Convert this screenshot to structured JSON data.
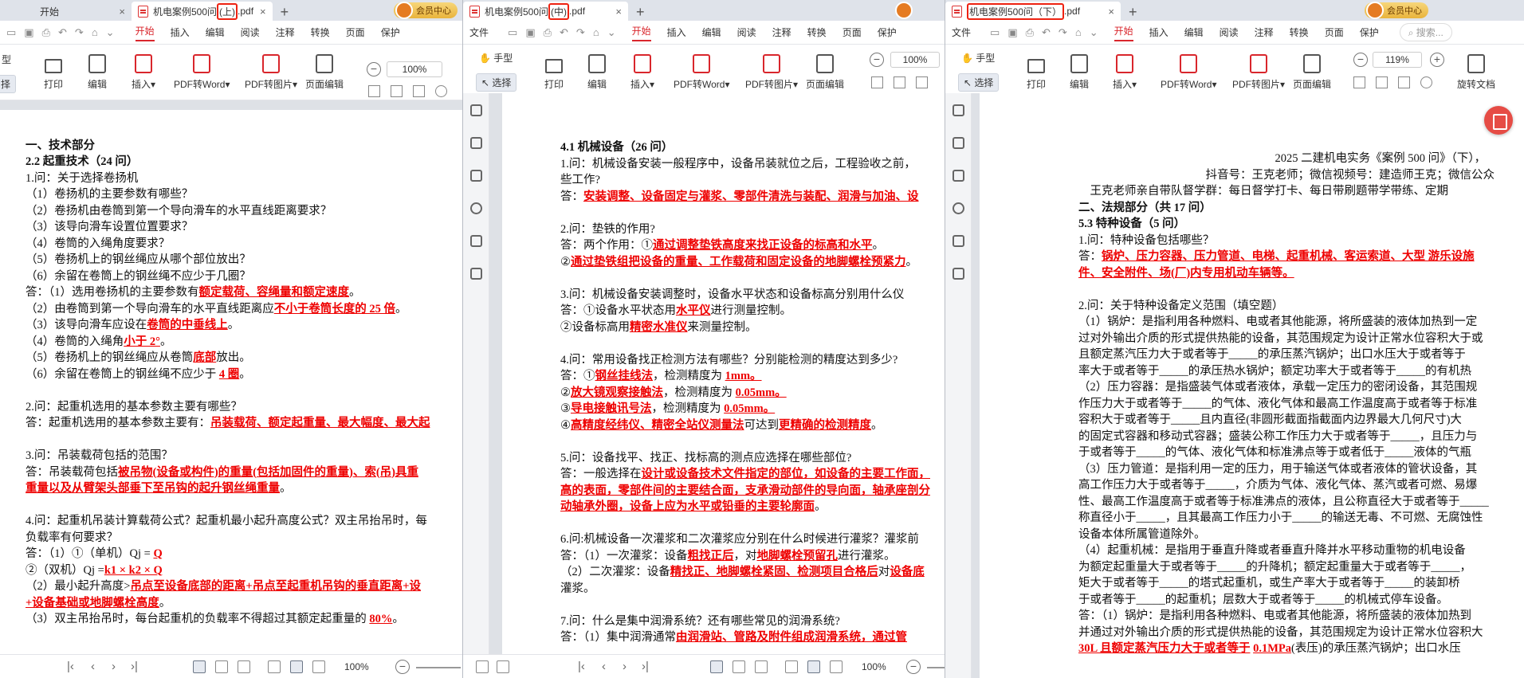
{
  "windows": [
    {
      "tabs": [
        {
          "label": "开始"
        },
        {
          "label_pre": "机电案例500问",
          "label_hl": "(上)",
          "label_post": ".pdf"
        }
      ],
      "vip": "会员中心",
      "menu": [
        "开始",
        "插入",
        "编辑",
        "阅读",
        "注释",
        "转换",
        "页面",
        "保护"
      ],
      "ribbon": {
        "print": "打印",
        "edit": "编辑",
        "insert": "插入",
        "pdf2word": "PDF转Word",
        "pdf2img": "PDF转图片",
        "pageedit": "页面编辑",
        "tool1": "型",
        "tool2": "择",
        "zoom": "100%"
      },
      "status": {
        "zoom": "100%"
      },
      "lines": [
        {
          "segs": [
            {
              "t": ""
            }
          ]
        },
        {
          "h": true,
          "segs": [
            {
              "t": "一、技术部分"
            }
          ]
        },
        {
          "h": true,
          "segs": [
            {
              "t": "2.2 起重技术（24 问）"
            }
          ]
        },
        {
          "segs": [
            {
              "t": "1.问：关于选择卷扬机"
            }
          ]
        },
        {
          "segs": [
            {
              "t": "（1）卷扬机的主要参数有哪些？"
            }
          ]
        },
        {
          "segs": [
            {
              "t": "（2）卷扬机由卷筒到第一个导向滑车的水平直线距离要求？"
            }
          ]
        },
        {
          "segs": [
            {
              "t": "（3）该导向滑车设置位置要求？"
            }
          ]
        },
        {
          "segs": [
            {
              "t": "（4）卷筒的入绳角度要求？"
            }
          ]
        },
        {
          "segs": [
            {
              "t": "（5）卷扬机上的钢丝绳应从哪个部位放出？"
            }
          ]
        },
        {
          "segs": [
            {
              "t": "（6）余留在卷筒上的钢丝绳不应少于几圈？"
            }
          ]
        },
        {
          "segs": [
            {
              "t": "答：（1）选用卷扬机的主要参数有"
            },
            {
              "t": "额定载荷、容绳量和额定速度",
              "r": true
            },
            {
              "t": "。"
            }
          ]
        },
        {
          "segs": [
            {
              "t": "（2）由卷筒到第一个导向滑车的水平直线距离应"
            },
            {
              "t": "不小于卷筒长度的 25 倍",
              "r": true
            },
            {
              "t": "。"
            }
          ]
        },
        {
          "segs": [
            {
              "t": "（3）该导向滑车应设在"
            },
            {
              "t": "卷筒的中垂线上",
              "r": true
            },
            {
              "t": "。"
            }
          ]
        },
        {
          "segs": [
            {
              "t": "（4）卷筒的入绳角"
            },
            {
              "t": "小于 2°",
              "r": true
            },
            {
              "t": "。"
            }
          ]
        },
        {
          "segs": [
            {
              "t": "（5）卷扬机上的钢丝绳应从卷筒"
            },
            {
              "t": "底部",
              "r": true
            },
            {
              "t": "放出。"
            }
          ]
        },
        {
          "segs": [
            {
              "t": "（6）余留在卷筒上的钢丝绳不应少于 "
            },
            {
              "t": "4 圈",
              "r": true
            },
            {
              "t": "。"
            }
          ]
        },
        {
          "segs": [
            {
              "t": ""
            }
          ]
        },
        {
          "segs": [
            {
              "t": "2.问：起重机选用的基本参数主要有哪些？"
            }
          ]
        },
        {
          "segs": [
            {
              "t": "答：起重机选用的基本参数主要有："
            },
            {
              "t": "吊装载荷、额定起重量、最大幅度、最大起",
              "r": true
            }
          ]
        },
        {
          "segs": [
            {
              "t": ""
            }
          ]
        },
        {
          "segs": [
            {
              "t": "3.问：吊装载荷包括的范围？"
            }
          ]
        },
        {
          "segs": [
            {
              "t": "答：吊装载荷包括"
            },
            {
              "t": "被吊物(设备或构件)的重量(包括加固件的重量)、索(吊)具重",
              "r": true
            }
          ]
        },
        {
          "segs": [
            {
              "t": "重量以及从臂架头部垂下至吊钩的起升钢丝绳重量",
              "r": true
            },
            {
              "t": "。"
            }
          ]
        },
        {
          "segs": [
            {
              "t": ""
            }
          ]
        },
        {
          "segs": [
            {
              "t": "4.问：起重机吊装计算载荷公式？起重机最小起升高度公式？双主吊抬吊时，每"
            }
          ]
        },
        {
          "segs": [
            {
              "t": "负载率有何要求？"
            }
          ]
        },
        {
          "segs": [
            {
              "t": "答：（1）①（单机）Qj = "
            },
            {
              "t": "Q",
              "r": true
            }
          ]
        },
        {
          "segs": [
            {
              "t": "②（双机）Qj ="
            },
            {
              "t": "k1 × k2 × Q",
              "r": true
            }
          ]
        },
        {
          "segs": [
            {
              "t": "（2）最小起升高度>"
            },
            {
              "t": "吊点至设备底部的距离+吊点至起重机吊钩的垂直距离+设",
              "r": true
            }
          ]
        },
        {
          "segs": [
            {
              "t": "+设备基础或地脚螺栓高度",
              "r": true
            },
            {
              "t": "。"
            }
          ]
        },
        {
          "segs": [
            {
              "t": "（3）双主吊抬吊时，每台起重机的负载率不得超过其额定起重量的 "
            },
            {
              "t": "80%",
              "r": true
            },
            {
              "t": "。"
            }
          ]
        }
      ]
    },
    {
      "tabs": [
        {
          "label_pre": "机电案例500问",
          "label_hl": "(中)",
          "label_post": ".pdf"
        }
      ],
      "menu": [
        "文件",
        "开始",
        "插入",
        "编辑",
        "阅读",
        "注释",
        "转换",
        "页面",
        "保护"
      ],
      "ribbon": {
        "hand": "手型",
        "select": "选择",
        "print": "打印",
        "edit": "编辑",
        "insert": "插入",
        "pdf2word": "PDF转Word",
        "pdf2img": "PDF转图片",
        "pageedit": "页面编辑",
        "zoom": "100%"
      },
      "status": {
        "zoom": "100%"
      },
      "lines": [
        {
          "h": true,
          "segs": [
            {
              "t": "4.1 机械设备（26 问）"
            }
          ]
        },
        {
          "segs": [
            {
              "t": "1.问：机械设备安装一般程序中，设备吊装就位之后，工程验收之前，"
            }
          ]
        },
        {
          "segs": [
            {
              "t": "些工作?"
            }
          ]
        },
        {
          "segs": [
            {
              "t": "答："
            },
            {
              "t": "安装调整、设备固定与灌浆、零部件清洗与装配、润滑与加油、设",
              "r": true
            }
          ]
        },
        {
          "segs": [
            {
              "t": ""
            }
          ]
        },
        {
          "segs": [
            {
              "t": "2.问：垫铁的作用?"
            }
          ]
        },
        {
          "segs": [
            {
              "t": "答：两个作用：①"
            },
            {
              "t": "通过调整垫铁高度来找正设备的标高和水平",
              "r": true
            },
            {
              "t": "。"
            }
          ]
        },
        {
          "segs": [
            {
              "t": "②"
            },
            {
              "t": "通过垫铁组把设备的重量、工作载荷和固定设备的地脚螺栓预紧力",
              "r": true
            },
            {
              "t": "。"
            }
          ]
        },
        {
          "segs": [
            {
              "t": ""
            }
          ]
        },
        {
          "segs": [
            {
              "t": "3.问：机械设备安装调整时，设备水平状态和设备标高分别用什么仪"
            }
          ]
        },
        {
          "segs": [
            {
              "t": "答：①设备水平状态用"
            },
            {
              "t": "水平仪",
              "r": true
            },
            {
              "t": "进行测量控制。"
            }
          ]
        },
        {
          "segs": [
            {
              "t": "②设备标高用"
            },
            {
              "t": "精密水准仪",
              "r": true
            },
            {
              "t": "来测量控制。"
            }
          ]
        },
        {
          "segs": [
            {
              "t": ""
            }
          ]
        },
        {
          "segs": [
            {
              "t": "4.问：常用设备找正检测方法有哪些？分别能检测的精度达到多少?"
            }
          ]
        },
        {
          "segs": [
            {
              "t": "答：①"
            },
            {
              "t": "钢丝挂线法",
              "r": true
            },
            {
              "t": "，检测精度为 "
            },
            {
              "t": "1mm。",
              "r": true
            }
          ]
        },
        {
          "segs": [
            {
              "t": "②"
            },
            {
              "t": "放大镜观察接触法",
              "r": true
            },
            {
              "t": "，检测精度为 "
            },
            {
              "t": "0.05mm。",
              "r": true
            }
          ]
        },
        {
          "segs": [
            {
              "t": "③"
            },
            {
              "t": "导电接触讯号法",
              "r": true
            },
            {
              "t": "，检测精度为 "
            },
            {
              "t": "0.05mm。",
              "r": true
            }
          ]
        },
        {
          "segs": [
            {
              "t": "④"
            },
            {
              "t": "高精度经纬仪、精密全站仪测量法",
              "r": true
            },
            {
              "t": "可达到"
            },
            {
              "t": "更精确的检测精度",
              "r": true
            },
            {
              "t": "。"
            }
          ]
        },
        {
          "segs": [
            {
              "t": ""
            }
          ]
        },
        {
          "segs": [
            {
              "t": "5.问：设备找平、找正、找标高的测点应选择在哪些部位?"
            }
          ]
        },
        {
          "segs": [
            {
              "t": "答：一般选择在"
            },
            {
              "t": "设计或设备技术文件指定的部位，如设备的主要工作面，",
              "r": true
            }
          ]
        },
        {
          "segs": [
            {
              "t": "高的表面，零部件间的主要结合面，支承滑动部件的导向面，轴承座剖分",
              "r": true
            }
          ]
        },
        {
          "segs": [
            {
              "t": "动轴承外圈，设备上应为水平或铅垂的主要轮廓面",
              "r": true
            },
            {
              "t": "。"
            }
          ]
        },
        {
          "segs": [
            {
              "t": ""
            }
          ]
        },
        {
          "segs": [
            {
              "t": "6.问:机械设备一次灌浆和二次灌浆应分别在什么时候进行灌浆？灌浆前"
            }
          ]
        },
        {
          "segs": [
            {
              "t": "答：（1）一次灌浆：设备"
            },
            {
              "t": "粗找正后",
              "r": true
            },
            {
              "t": "，对"
            },
            {
              "t": "地脚螺栓预留孔",
              "r": true
            },
            {
              "t": "进行灌浆。"
            }
          ]
        },
        {
          "segs": [
            {
              "t": "（2）二次灌浆：设备"
            },
            {
              "t": "精找正、地脚螺栓紧固、检测项目合格后",
              "r": true
            },
            {
              "t": "对"
            },
            {
              "t": "设备底",
              "r": true
            }
          ]
        },
        {
          "segs": [
            {
              "t": "灌浆。"
            }
          ]
        },
        {
          "segs": [
            {
              "t": ""
            }
          ]
        },
        {
          "segs": [
            {
              "t": "7.问：什么是集中润滑系统？还有哪些常见的润滑系统?"
            }
          ]
        },
        {
          "segs": [
            {
              "t": "答：（1）集中润滑通常"
            },
            {
              "t": "由润滑站、管路及附件组成润滑系统，通过管",
              "r": true
            }
          ]
        }
      ]
    },
    {
      "tabs": [
        {
          "label_pre": "",
          "label_hl": "机电案例500问（下）",
          "label_post": ".pdf"
        }
      ],
      "vip": "会员中心",
      "menu": [
        "文件",
        "开始",
        "插入",
        "编辑",
        "阅读",
        "注释",
        "转换",
        "页面",
        "保护"
      ],
      "search": "搜索...",
      "ribbon": {
        "hand": "手型",
        "select": "选择",
        "print": "打印",
        "edit": "编辑",
        "insert": "插入",
        "pdf2word": "PDF转Word",
        "pdf2img": "PDF转图片",
        "pageedit": "页面编辑",
        "rotate": "旋转文档",
        "zoom": "119%"
      },
      "lines": [
        {
          "segs": [
            {
              "t": "　　　　　　　　　　　　　　　　　2025 二建机电实务《案例 500 问》（下），"
            }
          ]
        },
        {
          "segs": [
            {
              "t": "　　　　　　　　　　　抖音号：王克老师；微信视频号：建造师王克；微信公众"
            }
          ]
        },
        {
          "segs": [
            {
              "t": "　王克老师亲自带队督学群：每日督学打卡、每日带刷题带学带练、定期"
            }
          ]
        },
        {
          "h": true,
          "segs": [
            {
              "t": "二、法规部分（共 17 问）"
            }
          ]
        },
        {
          "h": true,
          "segs": [
            {
              "t": "5.3 特种设备（5 问）"
            }
          ]
        },
        {
          "segs": [
            {
              "t": "1.问：特种设备包括哪些？"
            }
          ]
        },
        {
          "segs": [
            {
              "t": "答："
            },
            {
              "t": "锅炉、压力容器、压力管道、电梯、起重机械、客运索道、大型 游乐设施",
              "r": true
            }
          ]
        },
        {
          "segs": [
            {
              "t": "件、安全附件、场(厂)内专用机动车辆等。",
              "r": true
            }
          ]
        },
        {
          "segs": [
            {
              "t": ""
            }
          ]
        },
        {
          "segs": [
            {
              "t": "2.问：关于特种设备定义范围（填空题）"
            }
          ]
        },
        {
          "segs": [
            {
              "t": "（1）锅炉：是指利用各种燃料、电或者其他能源，将所盛装的液体加热到一定"
            }
          ]
        },
        {
          "segs": [
            {
              "t": "过对外输出介质的形式提供热能的设备，其范围规定为设计正常水位容积大于或"
            }
          ]
        },
        {
          "segs": [
            {
              "t": "且额定蒸汽压力大于或者等于_____的承压蒸汽锅炉；出口水压大于或者等于"
            }
          ]
        },
        {
          "segs": [
            {
              "t": "率大于或者等于_____的承压热水锅炉；额定功率大于或者等于_____的有机热"
            }
          ]
        },
        {
          "segs": [
            {
              "t": "（2）压力容器：是指盛装气体或者液体，承载一定压力的密闭设备，其范围规"
            }
          ]
        },
        {
          "segs": [
            {
              "t": "作压力大于或者等于_____的气体、液化气体和最高工作温度高于或者等于标准"
            }
          ]
        },
        {
          "segs": [
            {
              "t": "容积大于或者等于_____且内直径(非圆形截面指截面内边界最大几何尺寸)大"
            }
          ]
        },
        {
          "segs": [
            {
              "t": "的固定式容器和移动式容器；盛装公称工作压力大于或者等于_____，且压力与"
            }
          ]
        },
        {
          "segs": [
            {
              "t": "于或者等于_____的气体、液化气体和标准沸点等于或者低于_____液体的气瓶"
            }
          ]
        },
        {
          "segs": [
            {
              "t": "（3）压力管道：是指利用一定的压力，用于输送气体或者液体的管状设备，其"
            }
          ]
        },
        {
          "segs": [
            {
              "t": "高工作压力大于或者等于_____，介质为气体、液化气体、蒸汽或者可燃、易爆"
            }
          ]
        },
        {
          "segs": [
            {
              "t": "性、最高工作温度高于或者等于标准沸点的液体，且公称直径大于或者等于_____"
            }
          ]
        },
        {
          "segs": [
            {
              "t": "称直径小于_____，且其最高工作压力小于_____的输送无毒、不可燃、无腐蚀性"
            }
          ]
        },
        {
          "segs": [
            {
              "t": "设备本体所属管道除外。"
            }
          ]
        },
        {
          "segs": [
            {
              "t": "（4）起重机械：是指用于垂直升降或者垂直升降并水平移动重物的机电设备"
            }
          ]
        },
        {
          "segs": [
            {
              "t": "为额定起重量大于或者等于_____的升降机；额定起重量大于或者等于_____，"
            }
          ]
        },
        {
          "segs": [
            {
              "t": "矩大于或者等于_____的塔式起重机，或生产率大于或者等于_____的装卸桥"
            }
          ]
        },
        {
          "segs": [
            {
              "t": "于或者等于_____的起重机；层数大于或者等于_____的机械式停车设备。"
            }
          ]
        },
        {
          "segs": [
            {
              "t": "答：（1）锅炉：是指利用各种燃料、电或者其他能源，将所盛装的液体加热到"
            }
          ]
        },
        {
          "segs": [
            {
              "t": "并通过对外输出介质的形式提供热能的设备，其范围规定为设计正常水位容积大"
            }
          ]
        },
        {
          "segs": [
            {
              "t": "30L 且额定蒸汽压力大于或者等于",
              "r": true
            },
            {
              "t": " "
            },
            {
              "t": "0.1MPa",
              "r": true
            },
            {
              "t": "(表压)的承压蒸汽锅炉；出口水压"
            }
          ]
        }
      ]
    }
  ]
}
